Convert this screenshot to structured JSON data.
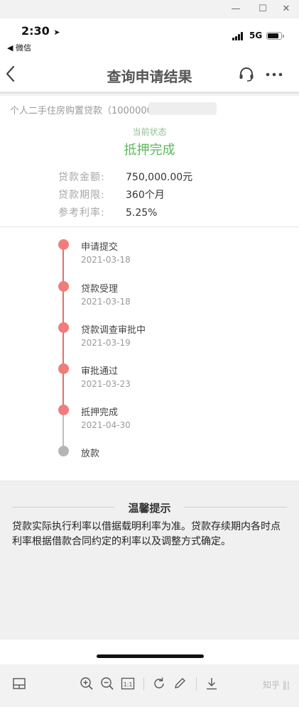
{
  "window": {
    "minimize": "—",
    "maximize": "☐",
    "close": "✕"
  },
  "status_bar": {
    "time": "2:30",
    "back_app": "◀ 微信",
    "network": "5G"
  },
  "nav": {
    "title": "查询申请结果"
  },
  "loan": {
    "product": "个人二手住房购置贷款（1000000",
    "state_label": "当前状态",
    "state_value": "抵押完成",
    "amount_label": "贷款金额:",
    "amount_value": "750,000.00元",
    "term_label": "贷款期限:",
    "term_value": "360个月",
    "rate_label": "参考利率:",
    "rate_value": "5.25%"
  },
  "timeline": {
    "steps": [
      {
        "name": "申请提交",
        "date": "2021-03-18"
      },
      {
        "name": "贷款受理",
        "date": "2021-03-18"
      },
      {
        "name": "贷款调查审批中",
        "date": "2021-03-19"
      },
      {
        "name": "审批通过",
        "date": "2021-03-23"
      },
      {
        "name": "抵押完成",
        "date": "2021-04-30"
      },
      {
        "name": "放款",
        "date": ""
      }
    ]
  },
  "tips": {
    "title": "温馨提示",
    "text": "贷款实际执行利率以借据载明利率为准。贷款存续期内各时点利率根据借款合同约定的利率以及调整方式确定。"
  },
  "toolbar": {
    "fit_label": "1:1",
    "watermark": "知乎"
  },
  "colors": {
    "accent_green": "#5cb85c",
    "timeline_red": "#f07c7c",
    "timeline_gray": "#b5b5b5"
  }
}
